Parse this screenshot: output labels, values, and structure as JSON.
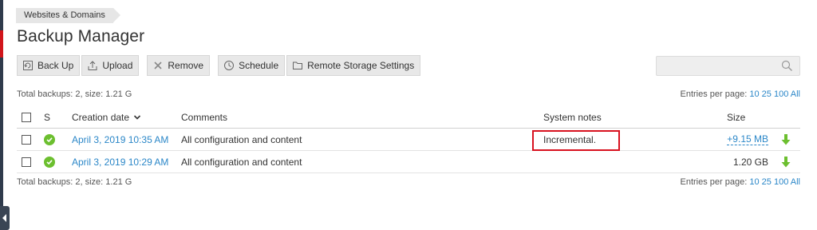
{
  "breadcrumb": {
    "label": "Websites & Domains"
  },
  "page": {
    "title": "Backup Manager"
  },
  "toolbar": {
    "back_up": "Back Up",
    "upload": "Upload",
    "remove": "Remove",
    "schedule": "Schedule",
    "remote_storage": "Remote Storage Settings"
  },
  "search": {
    "placeholder": ""
  },
  "summary": {
    "text": "Total backups: 2, size: 1.21 G"
  },
  "pagination": {
    "label": "Entries per page:",
    "options": [
      "10",
      "25",
      "100",
      "All"
    ]
  },
  "table": {
    "headers": {
      "s": "S",
      "creation_date": "Creation date",
      "comments": "Comments",
      "system_notes": "System notes",
      "size": "Size"
    },
    "rows": [
      {
        "date": "April 3, 2019 10:35 AM",
        "comment": "All configuration and content",
        "notes": "Incremental.",
        "size": "+9.15 MB"
      },
      {
        "date": "April 3, 2019 10:29 AM",
        "comment": "All configuration and content",
        "notes": "",
        "size": "1.20 GB"
      }
    ]
  },
  "colors": {
    "accent": "#2b87c8",
    "status_ok": "#6cbf2f",
    "highlight": "#d8121f"
  }
}
